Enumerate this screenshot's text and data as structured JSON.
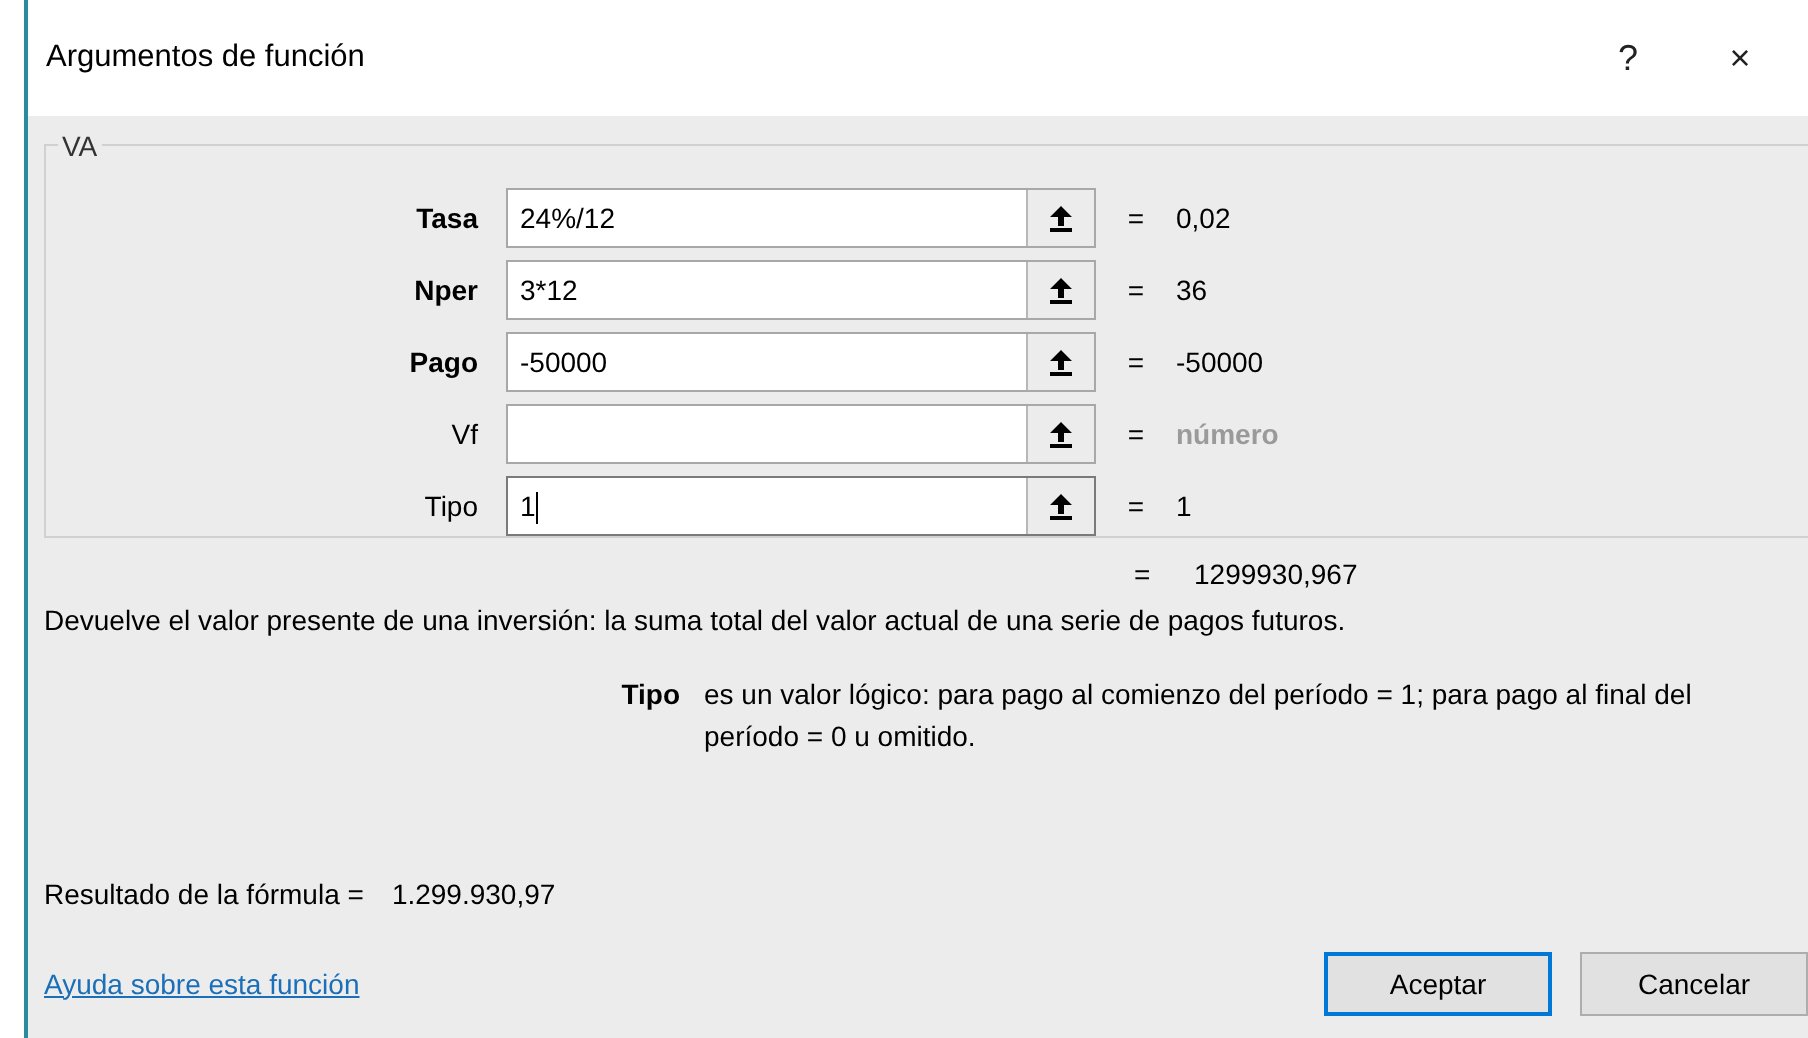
{
  "window": {
    "title": "Argumentos de función",
    "help_button": "?",
    "close_button": "×"
  },
  "group": {
    "title": "VA",
    "fields": [
      {
        "label": "Tasa",
        "required": true,
        "value": "24%/12",
        "focused": false,
        "result": "0,02",
        "result_dimmed": false
      },
      {
        "label": "Nper",
        "required": true,
        "value": "3*12",
        "focused": false,
        "result": "36",
        "result_dimmed": false
      },
      {
        "label": "Pago",
        "required": true,
        "value": "-50000",
        "focused": false,
        "result": "-50000",
        "result_dimmed": false
      },
      {
        "label": "Vf",
        "required": false,
        "focused": false,
        "result": "número",
        "result_dimmed": true
      },
      {
        "label": "Tipo",
        "required": false,
        "value": "1",
        "focused": true,
        "result": "1",
        "result_dimmed": false
      }
    ]
  },
  "equals_sign": "=",
  "total": "1299930,967",
  "description": "Devuelve el valor presente de una inversión: la suma total del valor actual de una serie de pagos futuros.",
  "argument_help": {
    "name": "Tipo",
    "text": "es un valor lógico: para pago al comienzo del período = 1; para pago al final del período = 0 u omitido."
  },
  "formula_result": {
    "label": "Resultado de la fórmula =",
    "value": "1.299.930,97"
  },
  "help_link": "Ayuda sobre esta función",
  "buttons": [
    {
      "label": "Aceptar",
      "default": true
    },
    {
      "label": "Cancelar",
      "default": false
    }
  ]
}
